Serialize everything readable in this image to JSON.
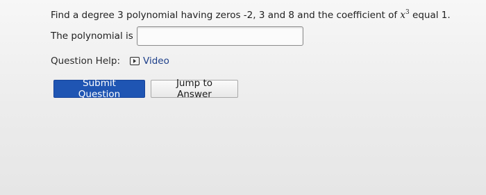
{
  "question": {
    "text_before": "Find a degree 3 polynomial having zeros -2, 3 and 8 and the coefficient of ",
    "math_var": "x",
    "math_exp": "3",
    "text_after": " equal 1."
  },
  "answer": {
    "label": "The polynomial is",
    "value": "",
    "placeholder": ""
  },
  "help": {
    "label": "Question Help:",
    "video_link": "Video",
    "video_icon": "play-icon"
  },
  "buttons": {
    "submit_label": "Submit Question",
    "jump_label": "Jump to Answer"
  },
  "colors": {
    "primary_button": "#1f55b3",
    "link": "#1d3f8a",
    "background": "#ececec"
  }
}
